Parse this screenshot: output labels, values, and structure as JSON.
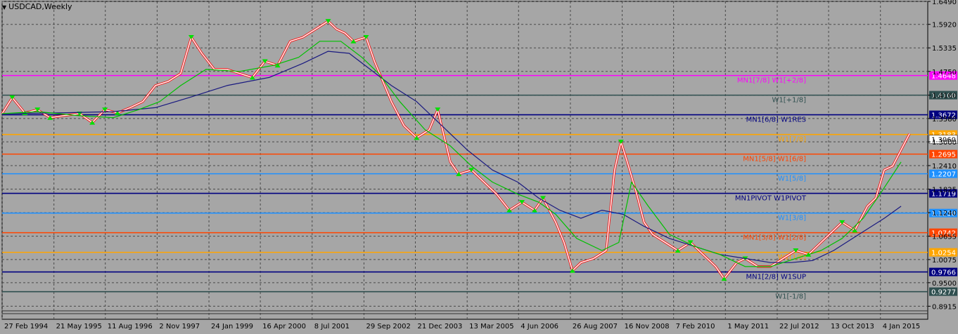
{
  "window": {
    "title": "USDCAD,Weekly",
    "menu_glyph": "▼"
  },
  "colors": {
    "background": "#a6a6a6",
    "grid": "#4a4a4a",
    "candle_up": "#ffffff",
    "candle_down": "#ff0000",
    "ma_slow": "#1a1a80",
    "ma_fast": "#00c000",
    "step_line": "#ff0000",
    "arrow_marker": "#00e000"
  },
  "chart_data": {
    "type": "line",
    "symbol": "USDCAD",
    "timeframe": "Weekly",
    "ylim": [
      0.88,
      1.649
    ],
    "xlim": [
      1994.16,
      2016.0
    ],
    "grid": "dashed vertical and horizontal",
    "y_ticks": [
      "1.6490",
      "1.5920",
      "1.5335",
      "1.4750",
      "1.4160",
      "1.3580",
      "1.3000",
      "1.2410",
      "1.1825",
      "1.1240",
      "1.0655",
      "1.0075",
      "0.9500",
      "0.8915"
    ],
    "x_ticks": [
      {
        "label": "27 Feb 1994",
        "x": 1994.16
      },
      {
        "label": "21 May 1995",
        "x": 1995.39
      },
      {
        "label": "11 Aug 1996",
        "x": 1996.61
      },
      {
        "label": "2 Nov 1997",
        "x": 1997.84
      },
      {
        "label": "24 Jan 1999",
        "x": 1999.07
      },
      {
        "label": "16 Apr 2000",
        "x": 2000.29
      },
      {
        "label": "8 Jul 2001",
        "x": 2001.52
      },
      {
        "label": "29 Sep 2002",
        "x": 2002.75
      },
      {
        "label": "21 Dec 2003",
        "x": 2003.97
      },
      {
        "label": "13 Mar 2005",
        "x": 2005.2
      },
      {
        "label": "4 Jun 2006",
        "x": 2006.42
      },
      {
        "label": "26 Aug 2007",
        "x": 2007.65
      },
      {
        "label": "16 Nov 2008",
        "x": 2008.88
      },
      {
        "label": "7 Feb 2010",
        "x": 2010.1
      },
      {
        "label": "1 May 2011",
        "x": 2011.33
      },
      {
        "label": "22 Jul 2012",
        "x": 2012.56
      },
      {
        "label": "13 Oct 2013",
        "x": 2013.78
      },
      {
        "label": "4 Jan 2015",
        "x": 2015.01
      }
    ],
    "levels": [
      {
        "price": 1.4648,
        "label": "MN1[7/8] W1[+2/8]",
        "tag": "1.4648",
        "color": "#ff00ff"
      },
      {
        "price": 1.416,
        "label": "W1[+1/8]",
        "tag": "1.4160",
        "color": "#2f4f4f"
      },
      {
        "price": 1.3672,
        "label": "MN1[6/8] W1RES",
        "tag": "1.3672",
        "color": "#000080"
      },
      {
        "price": 1.3183,
        "label": "W1[7/8]",
        "tag": "1.3183",
        "color": "#ffa500"
      },
      {
        "price": 1.2695,
        "label": "MN1[5/8] W1[6/8]",
        "tag": "1.2695",
        "color": "#ff4500"
      },
      {
        "price": 1.2207,
        "label": "W1[5/8]",
        "tag": "1.2207",
        "color": "#1e90ff"
      },
      {
        "price": 1.1719,
        "label": "MN1PIVOT W1PIVOT",
        "tag": "1.1719",
        "color": "#000080"
      },
      {
        "price": 1.123,
        "label": "W1[3/8]",
        "tag": "1.1230",
        "color": "#1e90ff"
      },
      {
        "price": 1.0742,
        "label": "MN1[3/8] W1[2/8]",
        "tag": "1.0742",
        "color": "#ff4500"
      },
      {
        "price": 1.0254,
        "label": "W1[1/8]",
        "tag": "1.0254",
        "color": "#ffa500"
      },
      {
        "price": 0.9766,
        "label": "MN1[2/8] W1SUP",
        "tag": "0.9766",
        "color": "#000080"
      },
      {
        "price": 0.9277,
        "label": "W1[-1/8]",
        "tag": "0.9277",
        "color": "#2f4f4f"
      }
    ],
    "current_price": {
      "price": 1.306,
      "tag": "1.3060",
      "color": "#ffffff"
    },
    "series": [
      {
        "name": "USDCAD",
        "role": "price",
        "x": [
          1994.16,
          1994.4,
          1994.7,
          1995.0,
          1995.3,
          1995.6,
          1996.0,
          1996.3,
          1996.6,
          1996.9,
          1997.2,
          1997.5,
          1997.8,
          1998.1,
          1998.4,
          1998.65,
          1998.9,
          1999.2,
          1999.5,
          1999.8,
          2000.1,
          2000.4,
          2000.7,
          2001.0,
          2001.3,
          2001.6,
          2001.9,
          2002.1,
          2002.3,
          2002.5,
          2002.8,
          2003.0,
          2003.2,
          2003.4,
          2003.7,
          2004.0,
          2004.3,
          2004.5,
          2004.8,
          2005.0,
          2005.3,
          2005.6,
          2005.9,
          2006.2,
          2006.5,
          2006.8,
          2007.0,
          2007.3,
          2007.5,
          2007.7,
          2007.9,
          2008.2,
          2008.5,
          2008.7,
          2008.85,
          2009.0,
          2009.2,
          2009.4,
          2009.6,
          2009.9,
          2010.2,
          2010.5,
          2010.8,
          2011.1,
          2011.3,
          2011.6,
          2011.8,
          2012.1,
          2012.4,
          2012.7,
          2013.0,
          2013.3,
          2013.6,
          2013.9,
          2014.1,
          2014.4,
          2014.7,
          2014.9,
          2015.1,
          2015.3,
          2015.5,
          2015.7
        ],
        "y": [
          1.37,
          1.41,
          1.372,
          1.38,
          1.36,
          1.365,
          1.37,
          1.348,
          1.38,
          1.372,
          1.385,
          1.4,
          1.44,
          1.45,
          1.47,
          1.56,
          1.52,
          1.48,
          1.48,
          1.47,
          1.46,
          1.5,
          1.49,
          1.55,
          1.56,
          1.58,
          1.6,
          1.58,
          1.57,
          1.55,
          1.56,
          1.5,
          1.45,
          1.4,
          1.34,
          1.31,
          1.33,
          1.38,
          1.25,
          1.22,
          1.23,
          1.2,
          1.17,
          1.13,
          1.15,
          1.13,
          1.16,
          1.1,
          1.05,
          0.98,
          1.0,
          1.01,
          1.03,
          1.23,
          1.3,
          1.25,
          1.18,
          1.1,
          1.07,
          1.05,
          1.03,
          1.05,
          1.02,
          0.99,
          0.96,
          1.0,
          1.01,
          0.99,
          0.99,
          1.01,
          1.03,
          1.02,
          1.05,
          1.08,
          1.1,
          1.08,
          1.14,
          1.16,
          1.23,
          1.24,
          1.28,
          1.32
        ]
      },
      {
        "name": "MA slow",
        "role": "ma_slow",
        "x": [
          1994.16,
          1995.5,
          1996.8,
          1997.8,
          1998.6,
          1999.5,
          2000.5,
          2001.3,
          2001.9,
          2002.4,
          2002.9,
          2003.4,
          2004.0,
          2004.6,
          2005.2,
          2005.8,
          2006.4,
          2006.9,
          2007.4,
          2007.9,
          2008.4,
          2008.9,
          2009.4,
          2010.0,
          2010.6,
          2011.2,
          2011.8,
          2012.4,
          2012.9,
          2013.4,
          2013.9,
          2014.5,
          2015.1,
          2015.5
        ],
        "y": [
          1.37,
          1.372,
          1.375,
          1.385,
          1.41,
          1.44,
          1.46,
          1.495,
          1.525,
          1.52,
          1.48,
          1.44,
          1.4,
          1.34,
          1.28,
          1.23,
          1.2,
          1.16,
          1.13,
          1.11,
          1.13,
          1.12,
          1.09,
          1.06,
          1.04,
          1.02,
          1.01,
          1.0,
          1.0,
          1.005,
          1.03,
          1.07,
          1.11,
          1.14
        ]
      },
      {
        "name": "MA fast",
        "role": "ma_fast",
        "x": [
          1994.16,
          1995.0,
          1996.0,
          1996.8,
          1997.4,
          1997.9,
          1998.4,
          1999.0,
          1999.8,
          2000.6,
          2001.2,
          2001.7,
          2002.2,
          2002.7,
          2003.1,
          2003.6,
          2004.2,
          2004.8,
          2005.3,
          2005.8,
          2006.4,
          2006.9,
          2007.3,
          2007.8,
          2008.4,
          2008.8,
          2009.1,
          2009.5,
          2010.0,
          2010.6,
          2011.2,
          2011.8,
          2012.4,
          2013.0,
          2013.6,
          2014.1,
          2014.6,
          2015.0,
          2015.5
        ],
        "y": [
          1.37,
          1.375,
          1.365,
          1.36,
          1.38,
          1.4,
          1.44,
          1.48,
          1.475,
          1.49,
          1.51,
          1.55,
          1.55,
          1.51,
          1.47,
          1.4,
          1.33,
          1.29,
          1.24,
          1.2,
          1.17,
          1.15,
          1.12,
          1.06,
          1.03,
          1.05,
          1.2,
          1.14,
          1.07,
          1.04,
          1.02,
          0.99,
          0.99,
          1.01,
          1.03,
          1.06,
          1.11,
          1.17,
          1.25
        ]
      }
    ]
  }
}
